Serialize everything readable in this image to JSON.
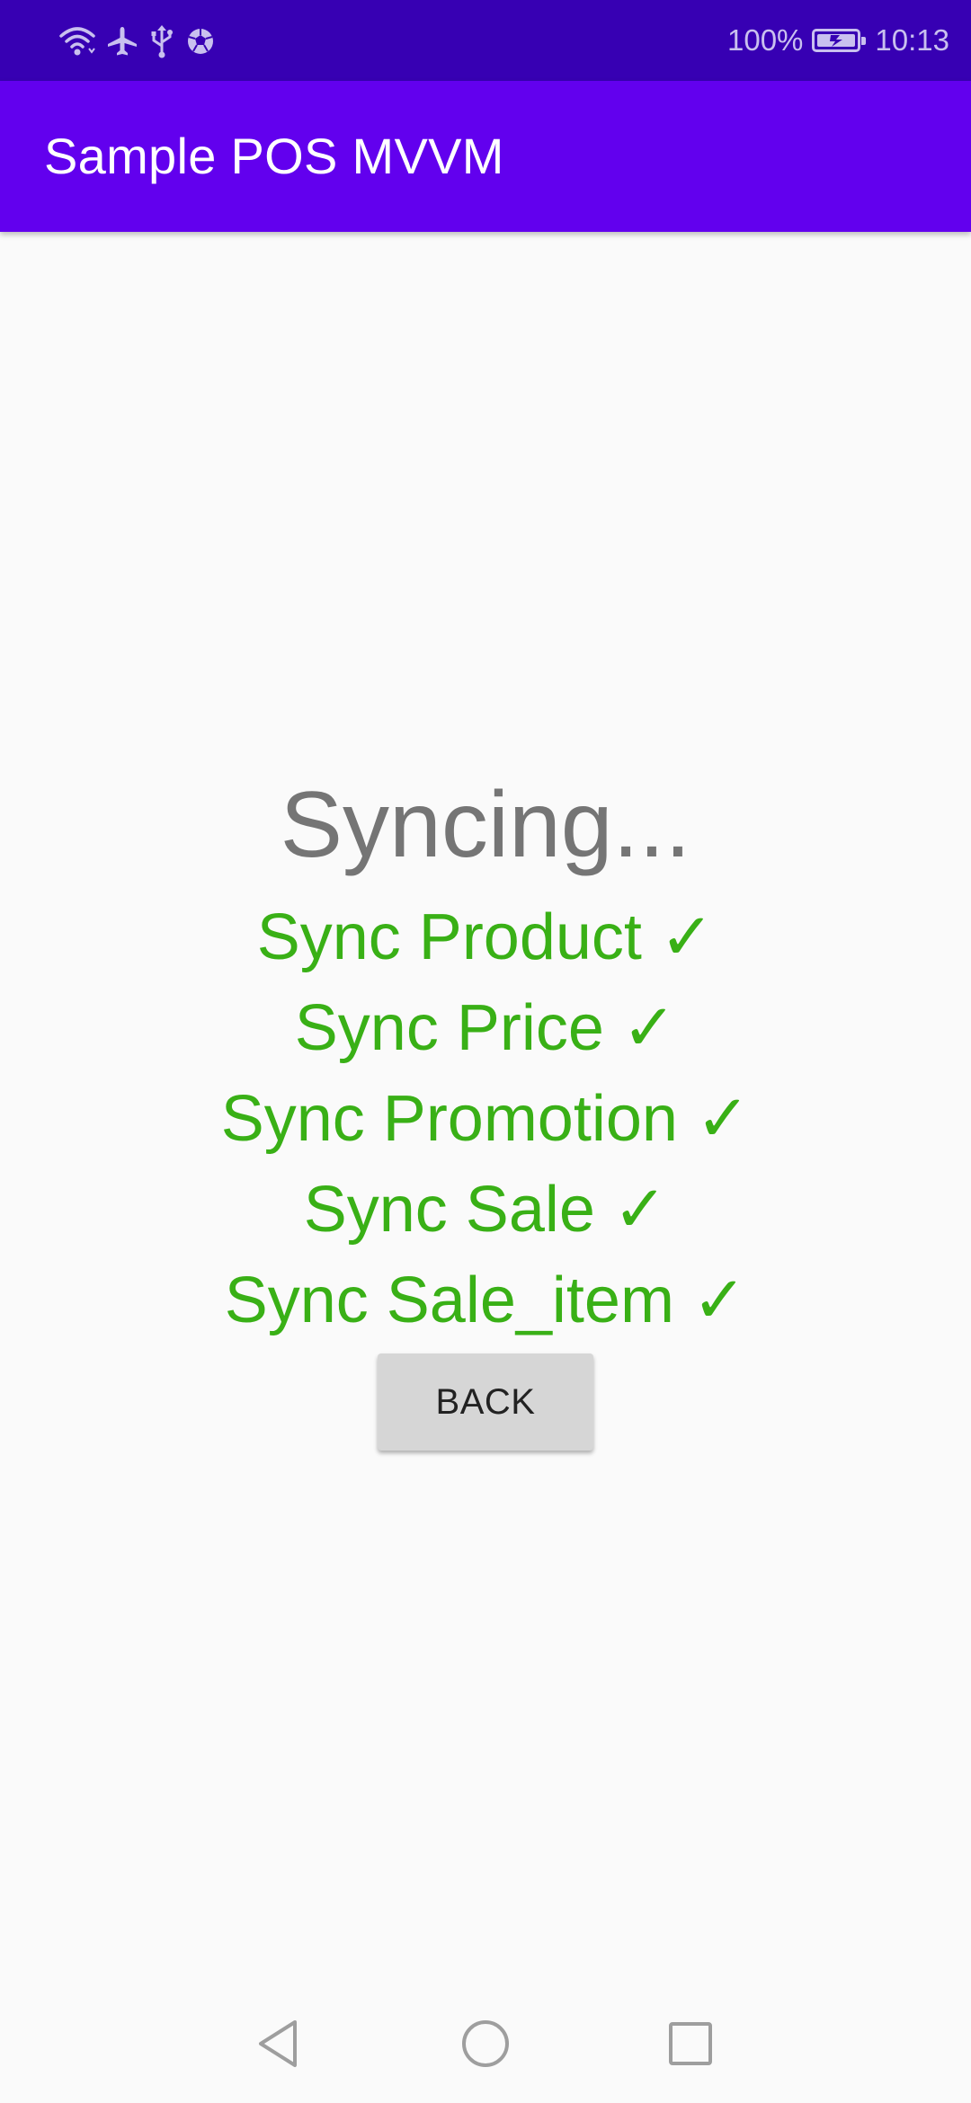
{
  "status_bar": {
    "icons": [
      "wifi-icon",
      "airplane-icon",
      "usb-icon",
      "soccer-ball-icon",
      "battery-charging-icon"
    ],
    "battery_text": "100%",
    "time": "10:13"
  },
  "app_bar": {
    "title": "Sample POS MVVM",
    "color": "#6200ee"
  },
  "main": {
    "syncing_title": "Syncing...",
    "sync_items": [
      {
        "label": "Sync Product ✓"
      },
      {
        "label": "Sync Price ✓"
      },
      {
        "label": "Sync Promotion ✓"
      },
      {
        "label": "Sync Sale ✓"
      },
      {
        "label": "Sync Sale_item ✓"
      }
    ],
    "back_label": "BACK",
    "success_color": "#39b016"
  },
  "nav_bar": {
    "icons": [
      "back-triangle-icon",
      "home-circle-icon",
      "recents-square-icon"
    ]
  }
}
